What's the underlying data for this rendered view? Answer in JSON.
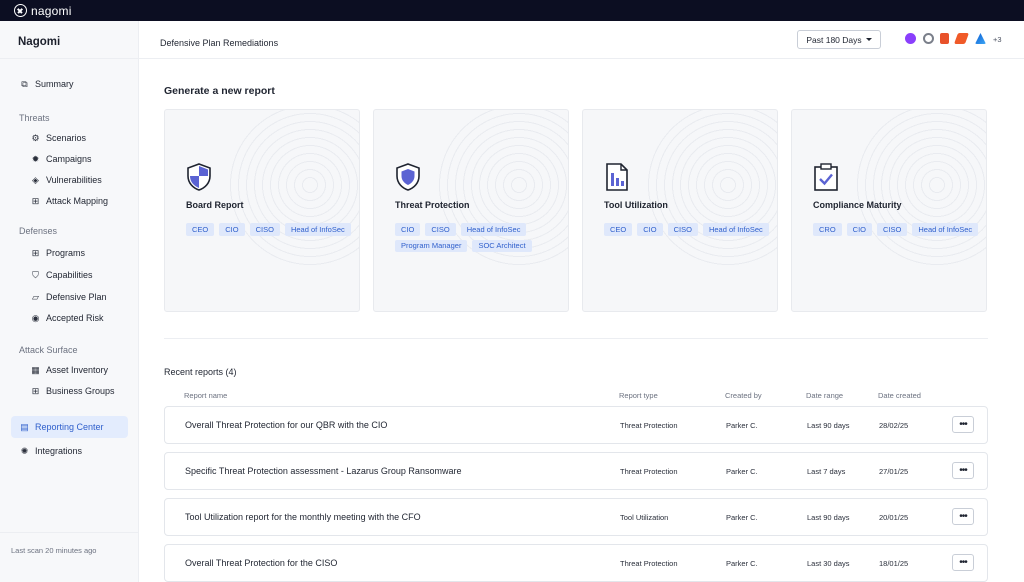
{
  "app": {
    "logo_text": "nagomi",
    "brand": "Nagomi"
  },
  "header": {
    "title": "Defensive Plan Remediations",
    "period": "Past 180 Days",
    "integrations_more": "+3",
    "integration_icons": [
      "purple-integration-icon",
      "gray-integration-icon",
      "office-integration-icon",
      "orange-integration-icon",
      "azure-integration-icon"
    ]
  },
  "sidebar": {
    "summary": "Summary",
    "threats_section": "Threats",
    "threats": [
      "Scenarios",
      "Campaigns",
      "Vulnerabilities",
      "Attack Mapping"
    ],
    "defenses_section": "Defenses",
    "defenses": [
      "Programs",
      "Capabilities",
      "Defensive Plan",
      "Accepted Risk"
    ],
    "attack_surface_section": "Attack Surface",
    "attack_surface": [
      "Asset Inventory",
      "Business Groups"
    ],
    "reporting_center": "Reporting Center",
    "integrations": "Integrations",
    "last_scan": "Last scan 20 minutes ago"
  },
  "generate": {
    "title": "Generate a new report",
    "cards": [
      {
        "title": "Board Report",
        "icon": "shield-icon",
        "tags": [
          "CEO",
          "CIO",
          "CISO",
          "Head of InfoSec"
        ]
      },
      {
        "title": "Threat Protection",
        "icon": "shield-protection-icon",
        "tags": [
          "CIO",
          "CISO",
          "Head of InfoSec",
          "Program Manager",
          "SOC Architect"
        ]
      },
      {
        "title": "Tool Utilization",
        "icon": "bar-chart-document-icon",
        "tags": [
          "CEO",
          "CIO",
          "CISO",
          "Head of InfoSec"
        ]
      },
      {
        "title": "Compliance Maturity",
        "icon": "clipboard-check-icon",
        "tags": [
          "CRO",
          "CIO",
          "CISO",
          "Head of InfoSec"
        ]
      }
    ]
  },
  "recent": {
    "title": "Recent reports (4)",
    "columns": [
      "Report name",
      "Report type",
      "Created by",
      "Date range",
      "Date created"
    ],
    "rows": [
      {
        "name": "Overall Threat Protection for our QBR with the CIO",
        "type": "Threat Protection",
        "created_by": "Parker C.",
        "range": "Last 90 days",
        "created": "28/02/25"
      },
      {
        "name": "Specific Threat Protection assessment - Lazarus Group Ransomware",
        "type": "Threat Protection",
        "created_by": "Parker C.",
        "range": "Last 7 days",
        "created": "27/01/25"
      },
      {
        "name": "Tool Utilization report for the monthly meeting with the CFO",
        "type": "Tool Utilization",
        "created_by": "Parker C.",
        "range": "Last 90 days",
        "created": "20/01/25"
      },
      {
        "name": "Overall Threat Protection for the CISO",
        "type": "Threat Protection",
        "created_by": "Parker C.",
        "range": "Last 30 days",
        "created": "18/01/25"
      }
    ],
    "more_label": "•••"
  },
  "colors": {
    "accent": "#2f5fcc",
    "active_bg": "#e3ecfd",
    "topbar": "#0c0e22"
  }
}
